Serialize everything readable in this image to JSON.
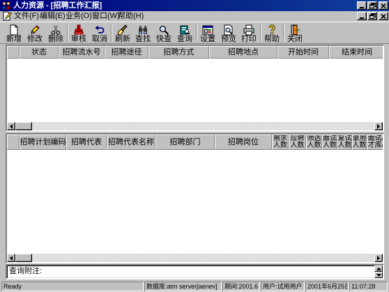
{
  "window": {
    "title": "人力资源 - [招聘工作汇报]",
    "app_icon": "hr-people-icon",
    "controls": [
      "minimize-icon",
      "restore-icon",
      "close-icon"
    ]
  },
  "menu": {
    "doc_icon": "document-pen-icon",
    "items": [
      "文件(F)",
      "编辑(E)",
      "业务(O)",
      "窗口(W)",
      "帮助(H)"
    ]
  },
  "toolbar": {
    "buttons": [
      {
        "label": "新增",
        "icon": "new-document-icon"
      },
      {
        "label": "修改",
        "icon": "pencil-icon"
      },
      {
        "label": "删除",
        "icon": "scissors-icon"
      },
      {
        "label": "审核",
        "icon": "stamp-icon"
      },
      {
        "label": "取消",
        "icon": "undo-arrow-icon"
      },
      {
        "label": "刷新",
        "icon": "brush-icon"
      },
      {
        "label": "查找",
        "icon": "binoculars-icon"
      },
      {
        "label": "快查",
        "icon": "magnifier-icon"
      },
      {
        "label": "查询",
        "icon": "query-document-icon"
      },
      {
        "label": "设置",
        "icon": "settings-window-icon"
      },
      {
        "label": "预览",
        "icon": "print-preview-icon"
      },
      {
        "label": "打印",
        "icon": "printer-icon"
      },
      {
        "label": "帮助",
        "icon": "help-icon"
      },
      {
        "label": "关闭",
        "icon": "exit-door-icon"
      }
    ]
  },
  "plan_grid": {
    "columns": [
      "状态",
      "招聘流水号",
      "招聘途径",
      "招聘方式",
      "招聘地点",
      "开始时间",
      "结束时间"
    ],
    "rows": []
  },
  "detail_grid": {
    "columns": [
      [
        "招聘计划编码"
      ],
      [
        "招聘代表"
      ],
      [
        "招聘代表名称"
      ],
      [
        "招聘部门"
      ],
      [
        "招聘岗位"
      ],
      [
        "需求",
        "人数"
      ],
      [
        "应聘",
        "人数"
      ],
      [
        "筛选",
        "人数"
      ],
      [
        "面试",
        "人数"
      ],
      [
        "复试",
        "人数"
      ],
      [
        "录用",
        "人数"
      ],
      [
        "面试/",
        "才库/"
      ]
    ],
    "rows": []
  },
  "note": {
    "label": "查询附注:",
    "value": ""
  },
  "status": {
    "ready": "Ready",
    "database": "数据库:atm server[aenev]",
    "period": "期间:2001.6",
    "user": "用户:试用用户",
    "date": "2001年6月25日",
    "time": "11:07:28"
  },
  "colors": {
    "title_bar": "#000080",
    "button_face": "#c0c0c0",
    "window_background": "#ffffff"
  }
}
